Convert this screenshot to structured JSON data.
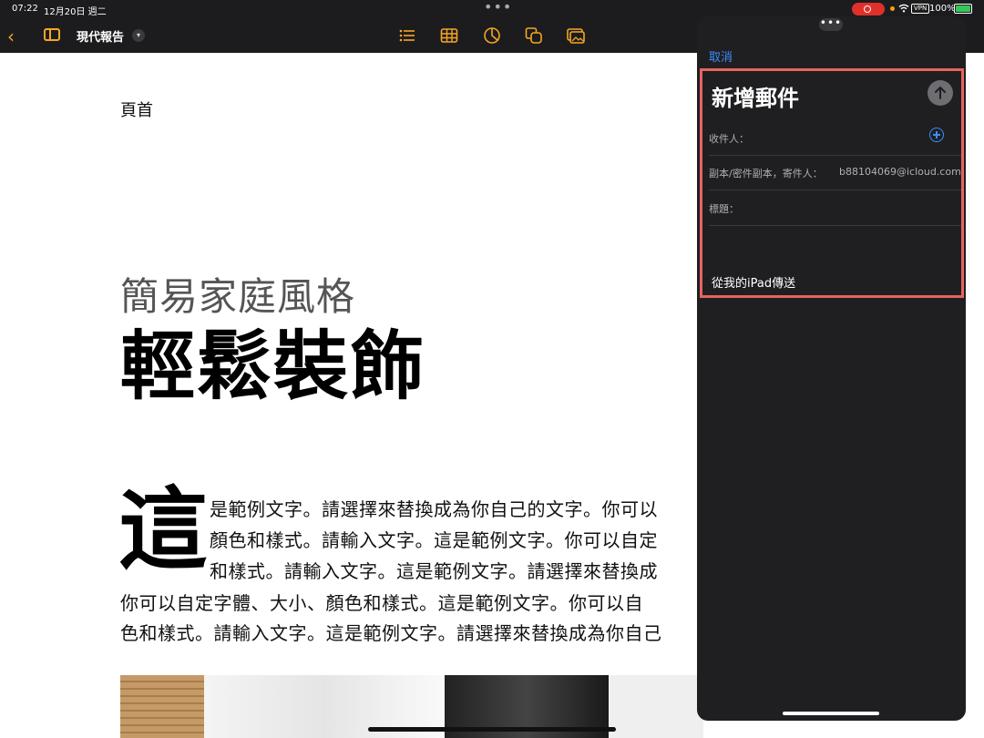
{
  "status_bar": {
    "time": "07:22",
    "date": "12月20日 週二",
    "vpn": "VPN",
    "battery": "100%"
  },
  "toolbar": {
    "document_title": "現代報告",
    "icons": [
      "chevron-left-icon",
      "sidebar-icon",
      "chevron-down-icon",
      "list-icon",
      "table-icon",
      "chart-icon",
      "shapes-icon",
      "media-icon"
    ],
    "accent_color": "#f5a623"
  },
  "document": {
    "header": "頁首",
    "subtitle": "簡易家庭風格",
    "title": "輕鬆裝飾",
    "dropcap": "這",
    "lines": [
      "是範例文字。請選擇來替換成為你自己的文字。你可以",
      "顏色和樣式。請輸入文字。這是範例文字。你可以自定",
      "和樣式。請輸入文字。這是範例文字。請選擇來替換成",
      "你可以自定字體、大小、顏色和樣式。這是範例文字。你可以自",
      "色和樣式。請輸入文字。這是範例文字。請選擇來替換成為你自己"
    ]
  },
  "mail": {
    "cancel_label": "取消",
    "heading": "新增郵件",
    "to_label": "收件人：",
    "cc_label": "副本/密件副本，寄件人：",
    "from_address": "b88104069@icloud.com",
    "subject_label": "標題：",
    "signature": "從我的iPad傳送",
    "link_color": "#3a8dff",
    "highlight_color": "#e5655f"
  }
}
